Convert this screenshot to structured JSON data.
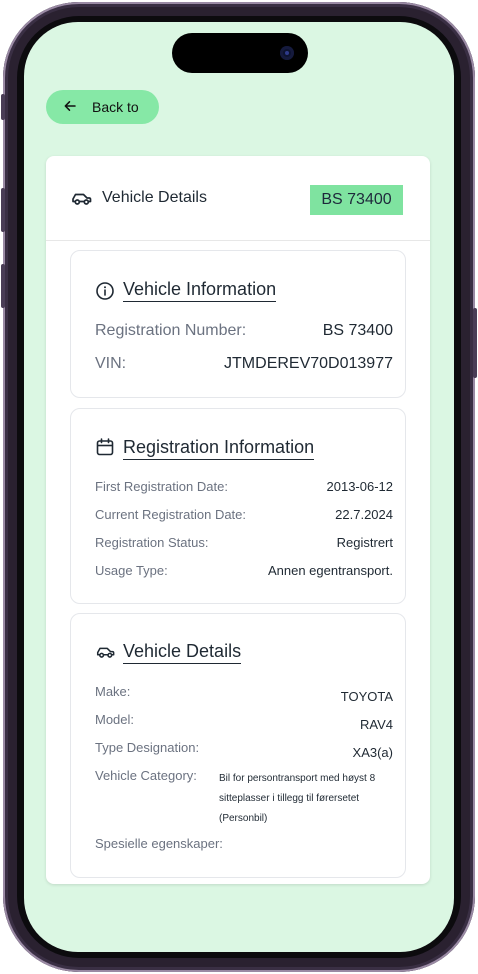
{
  "back_button": {
    "label": "Back to",
    "icon": "arrow-left-icon"
  },
  "card": {
    "title": "Vehicle Details",
    "plate": "BS 73400"
  },
  "vehicle_information": {
    "title": "Vehicle Information",
    "rows": [
      {
        "label": "Registration Number:",
        "value": "BS 73400"
      },
      {
        "label": "VIN:",
        "value": "JTMDEREV70D013977"
      }
    ]
  },
  "registration_information": {
    "title": "Registration Information",
    "rows": [
      {
        "label": "First Registration Date:",
        "value": "2013-06-12"
      },
      {
        "label": "Current Registration Date:",
        "value": "22.7.2024"
      },
      {
        "label": "Registration Status:",
        "value": "Registrert"
      },
      {
        "label": "Usage Type:",
        "value": "Annen egentransport."
      }
    ]
  },
  "vehicle_details": {
    "title": "Vehicle Details",
    "rows": [
      {
        "label": "Make:",
        "value": "TOYOTA"
      },
      {
        "label": "Model:",
        "value": "RAV4"
      },
      {
        "label": "Type Designation:",
        "value": "XA3(a)"
      }
    ],
    "category_label": "Vehicle Category:",
    "category_value": "Bil for persontransport med høyst 8 sitteplasser i tillegg til førersetet (Personbil)",
    "special_label": "Spesielle egenskaper:"
  },
  "colors": {
    "screen_bg": "#dbf7e3",
    "accent": "#7fe3a0",
    "back_button": "#86e8a6"
  }
}
